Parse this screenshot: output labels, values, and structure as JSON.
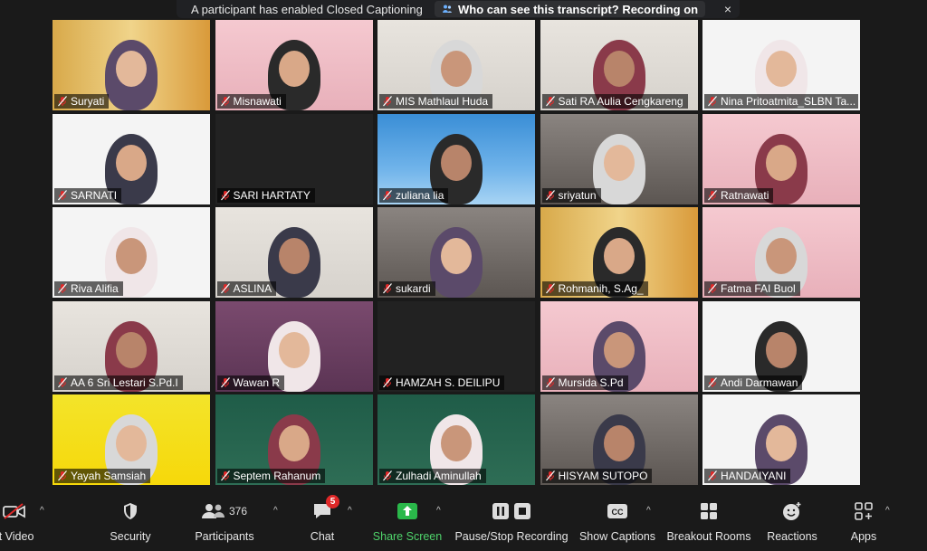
{
  "banner": {
    "caption_notice": "A participant has enabled Closed Captioning",
    "transcript_question": "Who can see this transcript? Recording on",
    "close_glyph": "×"
  },
  "participants": [
    {
      "name": "Suryati",
      "scene": "orange"
    },
    {
      "name": "Misnawati",
      "scene": "pink"
    },
    {
      "name": "MIS Mathlaul Huda",
      "scene": "wall-light"
    },
    {
      "name": "Sati RA Aulia Cengkareng",
      "scene": "wall-light"
    },
    {
      "name": "Nina Pritoatmita_SLBN Ta...",
      "scene": "banner"
    },
    {
      "name": "SARNATI",
      "scene": "banner"
    },
    {
      "name": "SARI HARTATY",
      "scene": "dark"
    },
    {
      "name": "zuliana lia",
      "scene": "blue"
    },
    {
      "name": "sriyatun",
      "scene": "grey"
    },
    {
      "name": "Ratnawati",
      "scene": "pink"
    },
    {
      "name": "Riva Alifia",
      "scene": "banner"
    },
    {
      "name": "ASLINA",
      "scene": "wall-light"
    },
    {
      "name": "sukardi",
      "scene": "grey"
    },
    {
      "name": "Rohmanih, S.Ag_",
      "scene": "orange"
    },
    {
      "name": "Fatma FAI Buol",
      "scene": "pink"
    },
    {
      "name": "AA 6 Sri Lestari S.Pd.I",
      "scene": "wall-light"
    },
    {
      "name": "Wawan R",
      "scene": "purple"
    },
    {
      "name": "HAMZAH S. DEILIPU",
      "scene": "dark"
    },
    {
      "name": "Mursida S.Pd",
      "scene": "pink"
    },
    {
      "name": "Andi Darmawan",
      "scene": "banner"
    },
    {
      "name": "Yayah Samsiah",
      "scene": "yellow"
    },
    {
      "name": "Septem Rahanum",
      "scene": "green"
    },
    {
      "name": "Zulhadi Aminullah",
      "scene": "green"
    },
    {
      "name": "HISYAM SUTOPO",
      "scene": "grey"
    },
    {
      "name": "HANDAIYANI",
      "scene": "banner"
    }
  ],
  "toolbar": {
    "start_video": "rt Video",
    "security": "Security",
    "participants": "Participants",
    "participants_count": "376",
    "chat": "Chat",
    "chat_badge": "5",
    "share_screen": "Share Screen",
    "recording": "Pause/Stop Recording",
    "captions": "Show Captions",
    "breakout": "Breakout Rooms",
    "reactions": "Reactions",
    "apps": "Apps"
  },
  "colors": {
    "background": "#1a1a1a",
    "share_green": "#4fd36b",
    "muted_red": "#e02828"
  }
}
